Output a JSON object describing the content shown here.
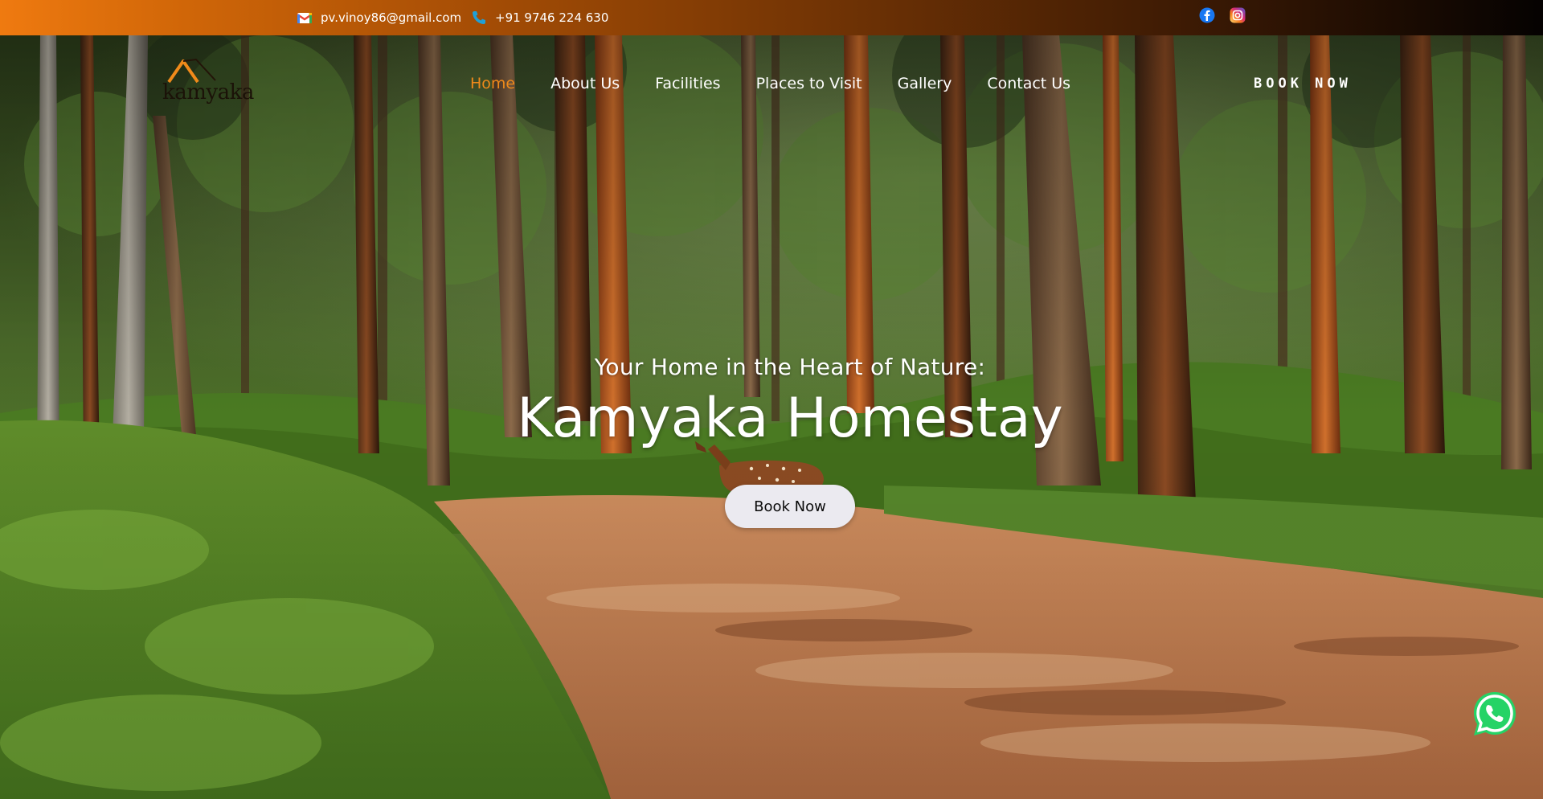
{
  "topbar": {
    "email": "pv.vinoy86@gmail.com",
    "phone": "+91 9746 224 630",
    "icons": {
      "email": "gmail-icon",
      "phone": "phone-icon",
      "facebook": "facebook-icon",
      "instagram": "instagram-icon"
    }
  },
  "brand": {
    "logo_text": "kamyaka"
  },
  "nav": {
    "items": [
      {
        "label": "Home",
        "active": true
      },
      {
        "label": "About Us",
        "active": false
      },
      {
        "label": "Facilities",
        "active": false
      },
      {
        "label": "Places to Visit",
        "active": false
      },
      {
        "label": "Gallery",
        "active": false
      },
      {
        "label": "Contact Us",
        "active": false
      }
    ],
    "book_label": "BOOK NOW"
  },
  "hero": {
    "tagline": "Your Home in the Heart of Nature:",
    "title": "Kamyaka Homestay",
    "cta_label": "Book Now"
  },
  "floating": {
    "whatsapp_icon": "whatsapp-icon"
  },
  "colors": {
    "accent_orange": "#ef8a1a",
    "topbar_start": "#ef7a10",
    "topbar_end": "#050201",
    "cta_bg": "#ebeaf0",
    "whatsapp_green": "#25d366"
  }
}
